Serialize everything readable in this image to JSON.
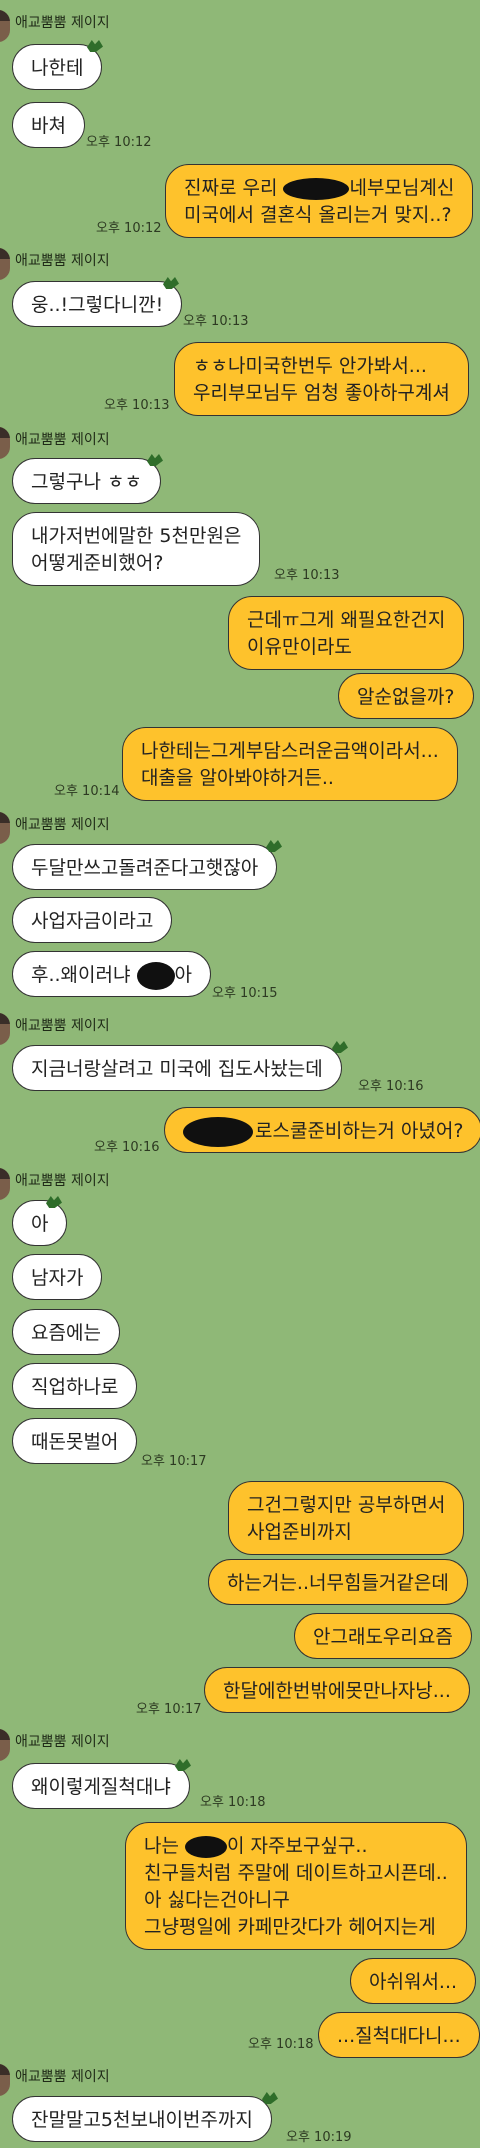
{
  "chat": {
    "sender_name": "애교뿜뿜 제이지",
    "messages": [
      {
        "side": "in",
        "text": "나한테"
      },
      {
        "side": "in",
        "text": "바쳐",
        "time": "오후 10:12"
      },
      {
        "side": "out",
        "lines": [
          "진짜로 우리 ",
          "네부모님계신",
          "미국에서 결혼식 올리는거 맞지..?"
        ],
        "time": "오후 10:12"
      },
      {
        "side": "in",
        "text": "웅..!그렇다니깐!",
        "time": "오후 10:13"
      },
      {
        "side": "out",
        "lines": [
          "ㅎㅎ나미국한번두 안가봐서...",
          "우리부모님두 엄청 좋아하구계셔"
        ],
        "time": "오후 10:13"
      },
      {
        "side": "in",
        "text": "그렇구나 ㅎㅎ"
      },
      {
        "side": "in",
        "lines": [
          "내가저번에말한 5천만원은",
          "어떻게준비했어?"
        ],
        "time": "오후 10:13"
      },
      {
        "side": "out",
        "lines": [
          "근데ㅠ그게 왜필요한건지",
          "이유만이라도"
        ]
      },
      {
        "side": "out",
        "text": "알순없을까?"
      },
      {
        "side": "out",
        "lines": [
          "나한테는그게부담스러운금액이라서...",
          "대출을 알아봐야하거든.."
        ],
        "time": "오후 10:14"
      },
      {
        "side": "in",
        "text": "두달만쓰고돌려준다고햇잖아"
      },
      {
        "side": "in",
        "text": "사업자금이라고"
      },
      {
        "side": "in",
        "text": "후..왜이러냐 ",
        "text_end": "아",
        "time": "오후 10:15"
      },
      {
        "side": "in",
        "text": "지금너랑살려고 미국에 집도사놨는데",
        "time": "오후 10:16"
      },
      {
        "side": "out",
        "text": "로스쿨준비하는거 아녔어?",
        "time": "오후 10:16"
      },
      {
        "side": "in",
        "text": "아"
      },
      {
        "side": "in",
        "text": "남자가"
      },
      {
        "side": "in",
        "text": "요즘에는"
      },
      {
        "side": "in",
        "text": "직업하나로"
      },
      {
        "side": "in",
        "text": "때돈못벌어",
        "time": "오후 10:17"
      },
      {
        "side": "out",
        "lines": [
          "그건그렇지만 공부하면서",
          "사업준비까지"
        ]
      },
      {
        "side": "out",
        "text": "하는거는..너무힘들거같은데"
      },
      {
        "side": "out",
        "text": "안그래도우리요즘"
      },
      {
        "side": "out",
        "text": "한달에한번밖에못만나자낭...",
        "time": "오후 10:17"
      },
      {
        "side": "in",
        "text": "왜이렇게질척대냐",
        "time": "오후 10:18"
      },
      {
        "side": "out",
        "lines": [
          "나는 ",
          "이 자주보구싶구..",
          "친구들처럼 주말에 데이트하고시픈데..",
          "아 싫다는건아니구",
          "그냥평일에 카페만갓다가 헤어지는게"
        ]
      },
      {
        "side": "out",
        "text": "아쉬워서..."
      },
      {
        "side": "out",
        "text": "...질척대다니...",
        "time": "오후 10:18"
      },
      {
        "side": "in",
        "text": "잔말말고5천보내이번주까지",
        "time": "오후 10:19"
      }
    ]
  }
}
